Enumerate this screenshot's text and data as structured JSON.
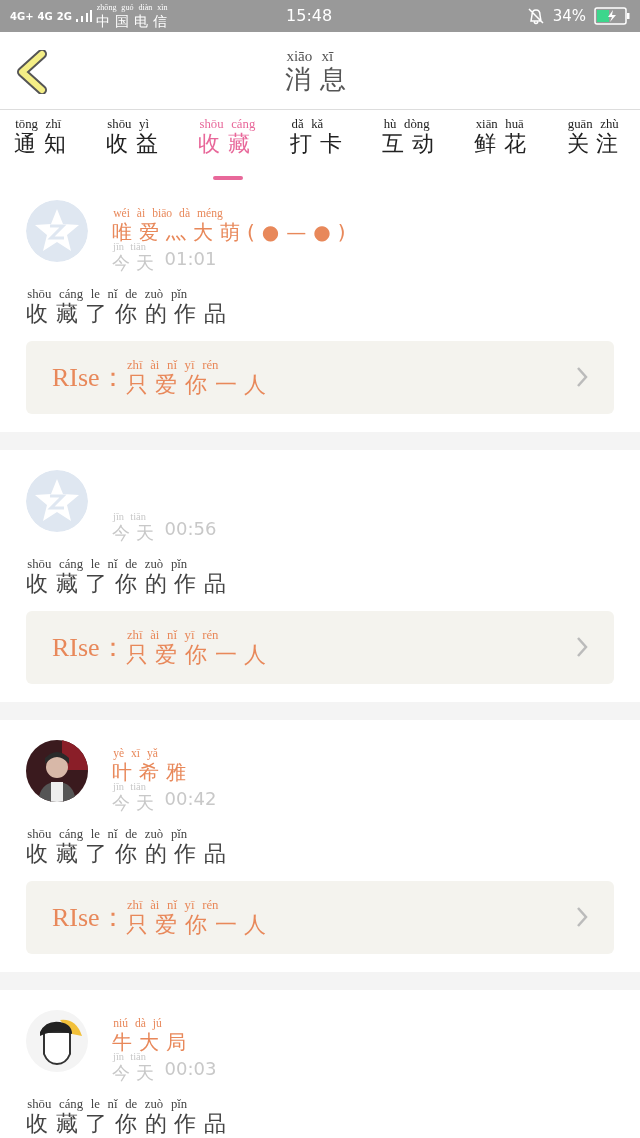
{
  "status_bar": {
    "network": [
      "4G+",
      "4G",
      "2G"
    ],
    "carrier": {
      "text": "中国电信",
      "pinyin": "zhōng guó diàn xìn"
    },
    "time": "15:48",
    "battery": "34%",
    "charging": true
  },
  "header": {
    "title": {
      "text": "消息",
      "pinyin": "xiāo xī"
    }
  },
  "tabs": [
    {
      "text": "通知",
      "pinyin": "tōng zhī",
      "selected": false
    },
    {
      "text": "收益",
      "pinyin": "shōu yì",
      "selected": false
    },
    {
      "text": "收藏",
      "pinyin": "shōu cáng",
      "selected": true
    },
    {
      "text": "打卡",
      "pinyin": "dǎ kǎ",
      "selected": false
    },
    {
      "text": "互动",
      "pinyin": "hù dòng",
      "selected": false
    },
    {
      "text": "鲜花",
      "pinyin": "xiān huā",
      "selected": false
    },
    {
      "text": "关注",
      "pinyin": "guān zhù",
      "selected": false
    }
  ],
  "messages": [
    {
      "avatar": {
        "kind": "default"
      },
      "name": {
        "text": "唯爱灬大萌(●—●)",
        "pinyin": "wéi ài biāo dà méng"
      },
      "date": {
        "text": "今天",
        "pinyin": "jīn tiān"
      },
      "time": "01:01",
      "action": {
        "text": "收藏了你的作品",
        "pinyin": "shōu cáng le nǐ de zuò pǐn"
      },
      "work": {
        "prefix": "RIse：",
        "title": {
          "text": "只爱你一人",
          "pinyin": "zhī ài nǐ yī rén"
        }
      }
    },
    {
      "avatar": {
        "kind": "default"
      },
      "date": {
        "text": "今天",
        "pinyin": "jīn tiān"
      },
      "time": "00:56",
      "action": {
        "text": "收藏了你的作品",
        "pinyin": "shōu cáng le nǐ de zuò pǐn"
      },
      "work": {
        "prefix": "RIse：",
        "title": {
          "text": "只爱你一人",
          "pinyin": "zhī ài nǐ yī rén"
        }
      }
    },
    {
      "name": {
        "text": "叶希雅",
        "pinyin": "yè xī yǎ"
      },
      "date": {
        "text": "今天",
        "pinyin": "jīn tiān"
      },
      "time": "00:42",
      "action": {
        "text": "收藏了你的作品",
        "pinyin": "shōu cáng le nǐ de zuò pǐn"
      },
      "work": {
        "prefix": "RIse：",
        "title": {
          "text": "只爱你一人",
          "pinyin": "zhī ài nǐ yī rén"
        }
      }
    },
    {
      "name": {
        "text": "牛大局",
        "pinyin": "niú dà jú"
      },
      "date": {
        "text": "今天",
        "pinyin": "jīn tiān"
      },
      "time": "00:03",
      "action": {
        "text": "收藏了你的作品",
        "pinyin": "shōu cáng le nǐ de zuò pǐn"
      }
    }
  ]
}
